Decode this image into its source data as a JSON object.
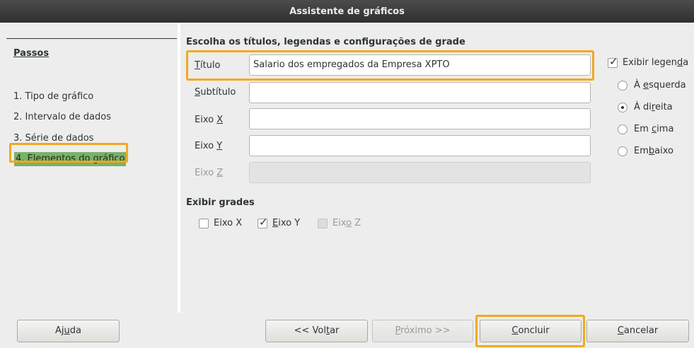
{
  "window": {
    "title": "Assistente de gráficos"
  },
  "sidebar": {
    "title": "Passos",
    "steps": [
      {
        "label": "1. Tipo de gráfico"
      },
      {
        "label": "2. Intervalo de dados"
      },
      {
        "label": "3. Série de dados"
      },
      {
        "label": "4. Elementos do gráfico"
      }
    ]
  },
  "main": {
    "heading": "Escolha os títulos, legendas e configurações de grade",
    "fields": {
      "title": {
        "label_pre": "",
        "label_mnemonic": "T",
        "label_post": "ítulo",
        "value": "Salario dos empregados da Empresa XPTO"
      },
      "subtitle": {
        "label_pre": "",
        "label_mnemonic": "S",
        "label_post": "ubtítulo",
        "value": ""
      },
      "x_axis": {
        "label_pre": "Eixo ",
        "label_mnemonic": "X",
        "label_post": "",
        "value": ""
      },
      "y_axis": {
        "label_pre": "Eixo ",
        "label_mnemonic": "Y",
        "label_post": "",
        "value": ""
      },
      "z_axis": {
        "label_pre": "Eixo ",
        "label_mnemonic": "Z",
        "label_post": "",
        "value": ""
      }
    },
    "grids": {
      "heading": "Exibir grades",
      "x": {
        "label_pre": "Eixo X",
        "checked": false
      },
      "y": {
        "label_pre": "",
        "label_mnemonic": "E",
        "label_post": "ixo Y",
        "checked": true
      },
      "z": {
        "label_pre": "Eix",
        "label_mnemonic": "o",
        "label_post": " Z",
        "checked": false,
        "disabled": true
      }
    },
    "legend": {
      "show": {
        "label_pre": "Exibir legen",
        "label_mnemonic": "d",
        "label_post": "a",
        "checked": true
      },
      "options": [
        {
          "label_pre": "À ",
          "label_mnemonic": "e",
          "label_post": "squerda",
          "selected": false
        },
        {
          "label_pre": "À di",
          "label_mnemonic": "r",
          "label_post": "eita",
          "selected": true
        },
        {
          "label_pre": "Em ",
          "label_mnemonic": "c",
          "label_post": "ima",
          "selected": false
        },
        {
          "label_pre": "Em",
          "label_mnemonic": "b",
          "label_post": "aixo",
          "selected": false
        }
      ]
    }
  },
  "footer": {
    "help": {
      "pre": "Aj",
      "mn": "u",
      "post": "da"
    },
    "back": {
      "pre": "<< Vol",
      "mn": "t",
      "post": "ar"
    },
    "next": {
      "pre": "",
      "mn": "P",
      "post": "róximo >>"
    },
    "finish": {
      "pre": "",
      "mn": "C",
      "post": "oncluir"
    },
    "cancel": {
      "pre": "",
      "mn": "C",
      "post": "ancelar"
    }
  },
  "accent_colors": {
    "highlight": "#f3a91c",
    "active_step": "#78b26a"
  }
}
